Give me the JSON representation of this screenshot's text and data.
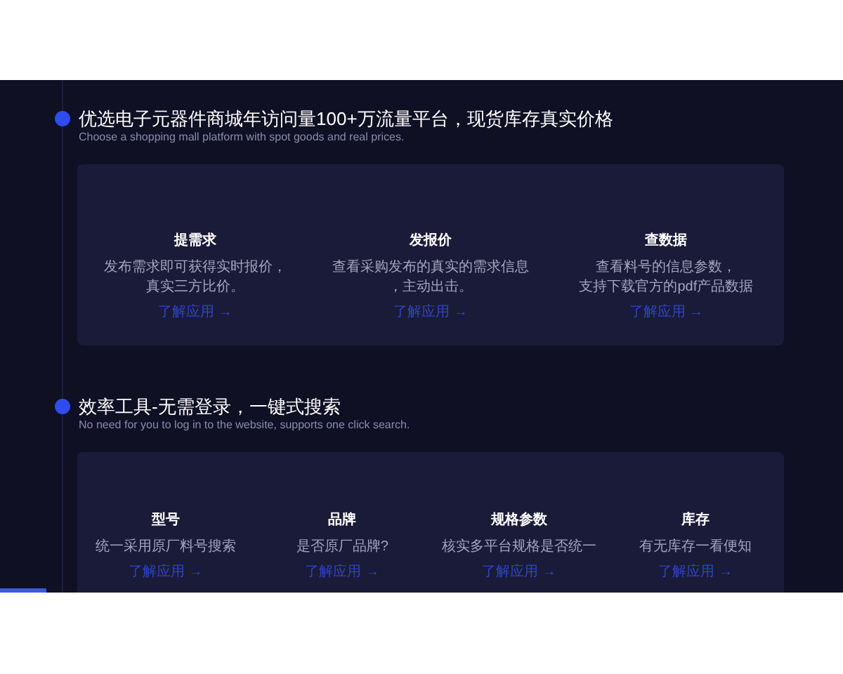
{
  "sections": [
    {
      "title": "优选电子元器件商城年访问量100+万流量平台，现货库存真实价格",
      "subtitle": "Choose a shopping mall platform with spot goods and real prices.",
      "features": [
        {
          "title": "提需求",
          "description": [
            "发布需求即可获得实时报价，",
            "真实三方比价。"
          ],
          "link": "了解应用 →"
        },
        {
          "title": "发报价",
          "description": [
            "查看采购发布的真实的需求信息",
            "，主动出击。"
          ],
          "link": "了解应用 →"
        },
        {
          "title": "查数据",
          "description": [
            "查看料号的信息参数，",
            "支持下载官方的pdf产品数据"
          ],
          "link": "了解应用 →"
        }
      ]
    },
    {
      "title": "效率工具-无需登录，一键式搜索",
      "subtitle": "No need for you to log in to the website, supports one click search.",
      "features": [
        {
          "title": "型号",
          "description": [
            "统一采用原厂料号搜索"
          ],
          "link": "了解应用 →"
        },
        {
          "title": "品牌",
          "description": [
            "是否原厂品牌?"
          ],
          "link": "了解应用 →"
        },
        {
          "title": "规格参数",
          "description": [
            "核实多平台规格是否统一"
          ],
          "link": "了解应用 →"
        },
        {
          "title": "库存",
          "description": [
            "有无库存一看便知"
          ],
          "link": "了解应用 →"
        }
      ]
    }
  ]
}
